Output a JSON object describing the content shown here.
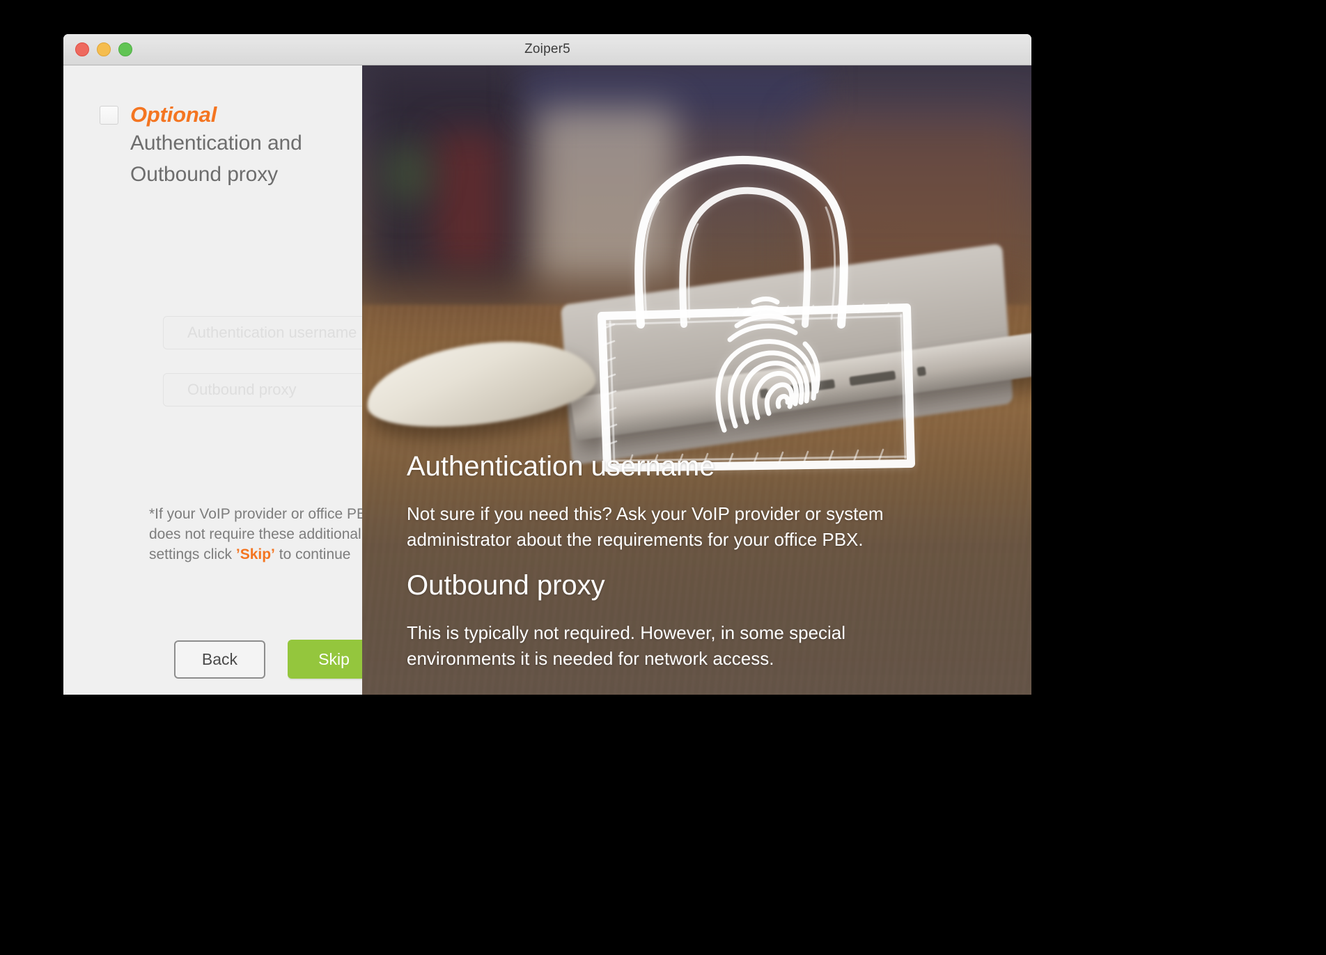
{
  "window": {
    "title": "Zoiper5",
    "traffic_lights": [
      "close",
      "minimize",
      "zoom"
    ]
  },
  "left_panel": {
    "optional_label": "Optional",
    "heading_line1": "Authentication and",
    "heading_line2": "Outbound proxy",
    "checkbox_checked": false,
    "fields": [
      {
        "name": "authentication-username",
        "placeholder": "Authentication username",
        "value": ""
      },
      {
        "name": "outbound-proxy",
        "placeholder": "Outbound proxy",
        "value": ""
      }
    ],
    "footnote": {
      "part1": "*If your VoIP provider or office PBX does not require these additional settings click ",
      "emphasis": "’Skip’",
      "part2": " to continue"
    },
    "buttons": {
      "back_label": "Back",
      "skip_label": "Skip"
    }
  },
  "right_panel": {
    "illustration": "padlock-fingerprint-icon",
    "sections": [
      {
        "heading": "Authentication username",
        "body": "Not sure if you need this? Ask your VoIP provider or system administrator about the requirements for your office PBX."
      },
      {
        "heading": "Outbound proxy",
        "body": "This is typically not required. However, in some special environments it is needed for network access."
      }
    ]
  },
  "colors": {
    "accent_orange": "#f47521",
    "primary_green": "#94c63d",
    "panel_background": "#f0f0f0",
    "heading_gray": "#6d6d6d",
    "hero_overlay_brown": "#6b5a4e"
  }
}
